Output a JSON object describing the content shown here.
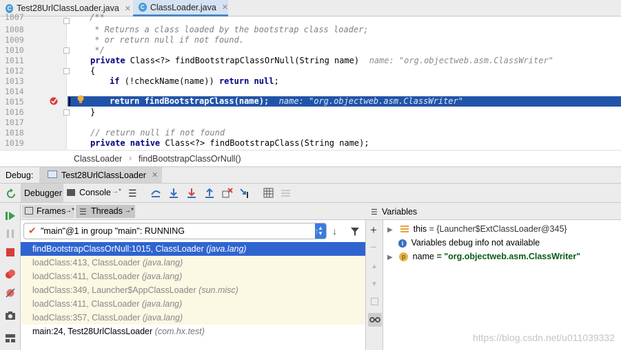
{
  "tabs": [
    {
      "label": "Test28UrlClassLoader.java",
      "active": false
    },
    {
      "label": "ClassLoader.java",
      "active": true
    }
  ],
  "editor": {
    "lines": [
      {
        "num": "1007",
        "text": "/**"
      },
      {
        "num": "1008",
        "text": " * Returns a class loaded by the bootstrap class loader;"
      },
      {
        "num": "1009",
        "text": " * or return null if not found."
      },
      {
        "num": "1010",
        "text": " */"
      },
      {
        "num": "1011",
        "kw": "private",
        "text": " Class<?> findBootstrapClassOrNull(String name)",
        "hint": "name: \"org.objectweb.asm.ClassWriter\""
      },
      {
        "num": "1012",
        "text": "{"
      },
      {
        "num": "1013",
        "kw": "if",
        "text": " (!checkName(name)) ",
        "kw2": "return null",
        "text2": ";"
      },
      {
        "num": "1014",
        "text": ""
      },
      {
        "num": "1015",
        "kw": "return",
        "text": " findBootstrapClass(name);",
        "hint": "name: \"org.objectweb.asm.ClassWriter\""
      },
      {
        "num": "1016",
        "text": "}"
      },
      {
        "num": "1017",
        "text": ""
      },
      {
        "num": "1018",
        "text": "// return null if not found"
      },
      {
        "num": "1019",
        "kw": "private native",
        "text": " Class<?> findBootstrapClass(String name);"
      }
    ]
  },
  "breadcrumb": {
    "class": "ClassLoader",
    "method": "findBootstrapClassOrNull()"
  },
  "debug": {
    "label": "Debug:",
    "config": "Test28UrlClassLoader",
    "tab_debugger": "Debugger",
    "tab_console": "Console",
    "console_arrow": "→*"
  },
  "frames": {
    "tab_frames": "Frames",
    "tab_threads": "Threads",
    "arrow": "→*",
    "thread": "\"main\"@1 in group \"main\": RUNNING",
    "items": [
      {
        "method": "findBootstrapClassOrNull:1015, ClassLoader",
        "pkg": "(java.lang)",
        "state": "selected"
      },
      {
        "method": "loadClass:413, ClassLoader",
        "pkg": "(java.lang)",
        "state": "lib"
      },
      {
        "method": "loadClass:411, ClassLoader",
        "pkg": "(java.lang)",
        "state": "lib"
      },
      {
        "method": "loadClass:349, Launcher$AppClassLoader",
        "pkg": "(sun.misc)",
        "state": "lib"
      },
      {
        "method": "loadClass:411, ClassLoader",
        "pkg": "(java.lang)",
        "state": "lib"
      },
      {
        "method": "loadClass:357, ClassLoader",
        "pkg": "(java.lang)",
        "state": "lib"
      },
      {
        "method": "main:24, Test28UrlClassLoader",
        "pkg": "(com.hx.test)",
        "state": "normal"
      }
    ]
  },
  "variables": {
    "title": "Variables",
    "items": [
      {
        "name": "this",
        "value": "= {Launcher$ExtClassLoader@345}"
      },
      {
        "name": "",
        "value": "Variables debug info not available"
      },
      {
        "name": "name",
        "value": "= \"org.objectweb.asm.ClassWriter\""
      }
    ]
  },
  "watermark": "https://blog.csdn.net/u011039332",
  "colors": {
    "selection": "#2154a8",
    "frame_selected": "#2f64d1",
    "lib_frame_bg": "#fbf8e3",
    "comment": "#808080",
    "keyword": "#000080"
  }
}
